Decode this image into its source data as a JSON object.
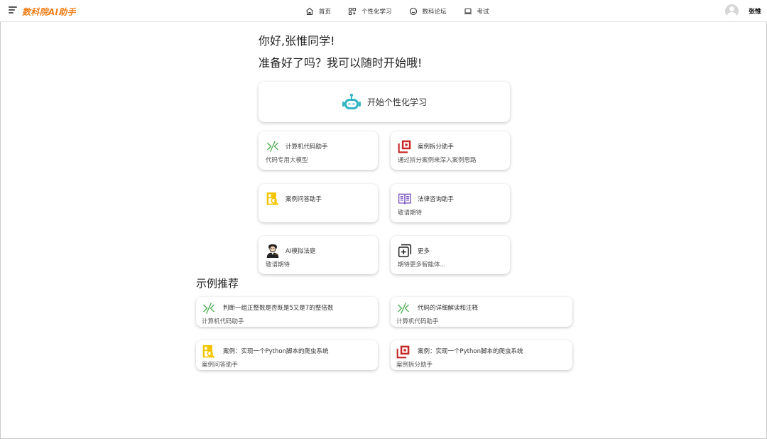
{
  "app": {
    "brand": "数科院AI助手"
  },
  "nav": [
    {
      "label": "首页",
      "icon": "home-icon"
    },
    {
      "label": "个性化学习",
      "icon": "apps-icon"
    },
    {
      "label": "数科论坛",
      "icon": "smile-icon"
    },
    {
      "label": "考试",
      "icon": "laptop-icon"
    }
  ],
  "user": {
    "name": "张惟"
  },
  "greeting": {
    "line1": "你好,张惟同学!",
    "line2": "准备好了吗？我可以随时开始哦!"
  },
  "start": {
    "label": "开始个性化学习",
    "icon": "robot-icon"
  },
  "tools": [
    {
      "title": "计算机代码助手",
      "sub": "代码专用大模型",
      "icon": "code-arrows-icon"
    },
    {
      "title": "案例拆分助手",
      "sub": "通过拆分案例来深入案例思路",
      "icon": "copy-cases-icon"
    },
    {
      "title": "案例问答助手",
      "sub": "",
      "icon": "document-search-icon"
    },
    {
      "title": "法律咨询助手",
      "sub": "敬请期待",
      "icon": "open-book-icon"
    },
    {
      "title": "AI模拟法庭",
      "sub": "敬请期待",
      "icon": "judge-avatar-icon"
    },
    {
      "title": "更多",
      "sub": "期待更多智能体...",
      "icon": "add-square-icon"
    }
  ],
  "examples": {
    "title": "示例推荐",
    "items": [
      {
        "title": "判断一组正整数是否既是5又是7的整倍数",
        "sub": "计算机代码助手",
        "icon": "code-arrows-icon"
      },
      {
        "title": "代码的详细解读和注释",
        "sub": "计算机代码助手",
        "icon": "code-arrows-icon"
      },
      {
        "title": "案例：实现一个Python脚本的爬虫系统",
        "sub": "案例问答助手",
        "icon": "document-search-icon"
      },
      {
        "title": "案例：实现一个Python脚本的爬虫系统",
        "sub": "案例拆分助手",
        "icon": "copy-cases-icon"
      }
    ]
  },
  "colors": {
    "brand": "#f07d17",
    "robot": "#36b6c4",
    "code": "#4caf50",
    "case_split": "#c62828",
    "case_qa": "#f2c500",
    "law_book": "#7e57c2"
  }
}
